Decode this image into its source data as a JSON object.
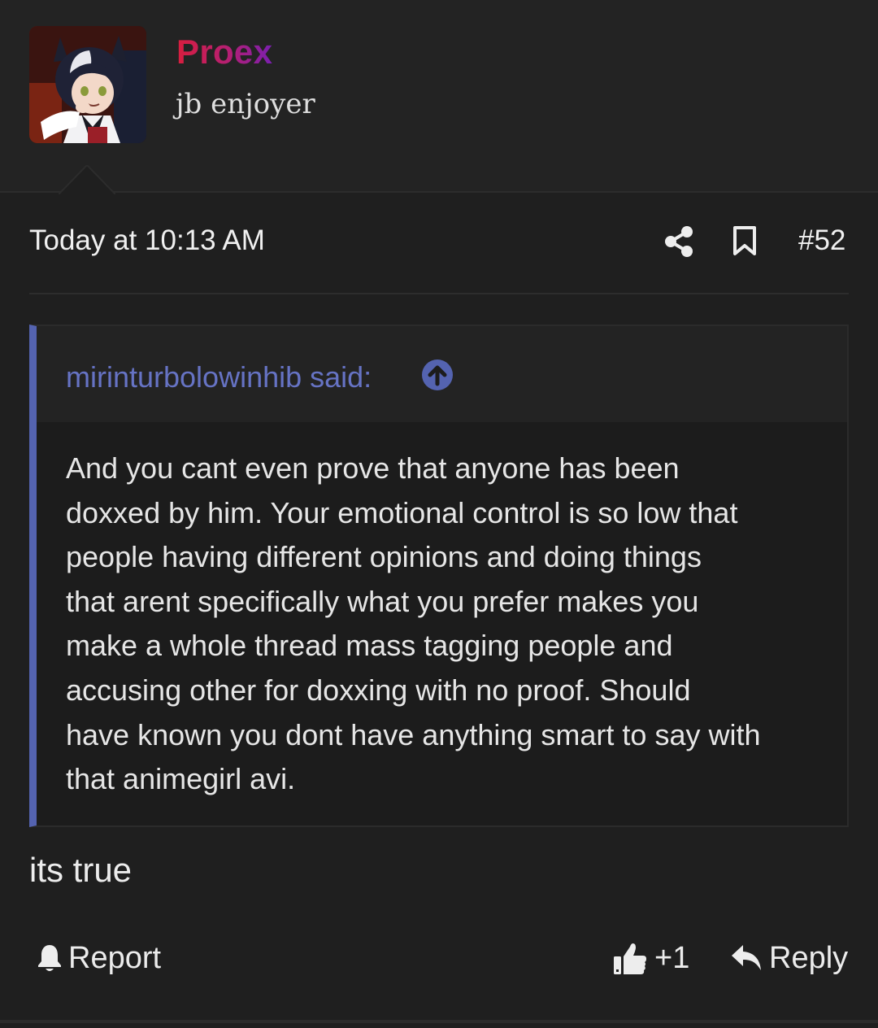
{
  "user": {
    "name": "Proex",
    "title": "jb enjoyer",
    "name_gradient": [
      "#d81e3e",
      "#7a1fb0"
    ]
  },
  "post": {
    "time": "Today at 10:13 AM",
    "number": "#52",
    "message": "its true"
  },
  "quote": {
    "author_label": "mirinturbolowinhib said:",
    "accent_color": "#5463b0",
    "lines": [
      "And you cant even prove that anyone has been",
      "doxxed by him. Your emotional control is so low that",
      "people having different opinions and doing things",
      "that arent specifically what you prefer makes you",
      "make a whole thread mass tagging people and",
      "accusing other for doxxing with no proof. Should",
      "have known you dont have anything smart to say with",
      "that animegirl avi."
    ]
  },
  "actions": {
    "report": "Report",
    "like": "+1",
    "reply": "Reply"
  },
  "icons": {
    "share": "share-icon",
    "bookmark": "bookmark-icon",
    "quote_jump": "arrow-up-circle-icon",
    "report": "bell-icon",
    "like": "thumbs-up-icon",
    "reply": "reply-arrow-icon"
  }
}
